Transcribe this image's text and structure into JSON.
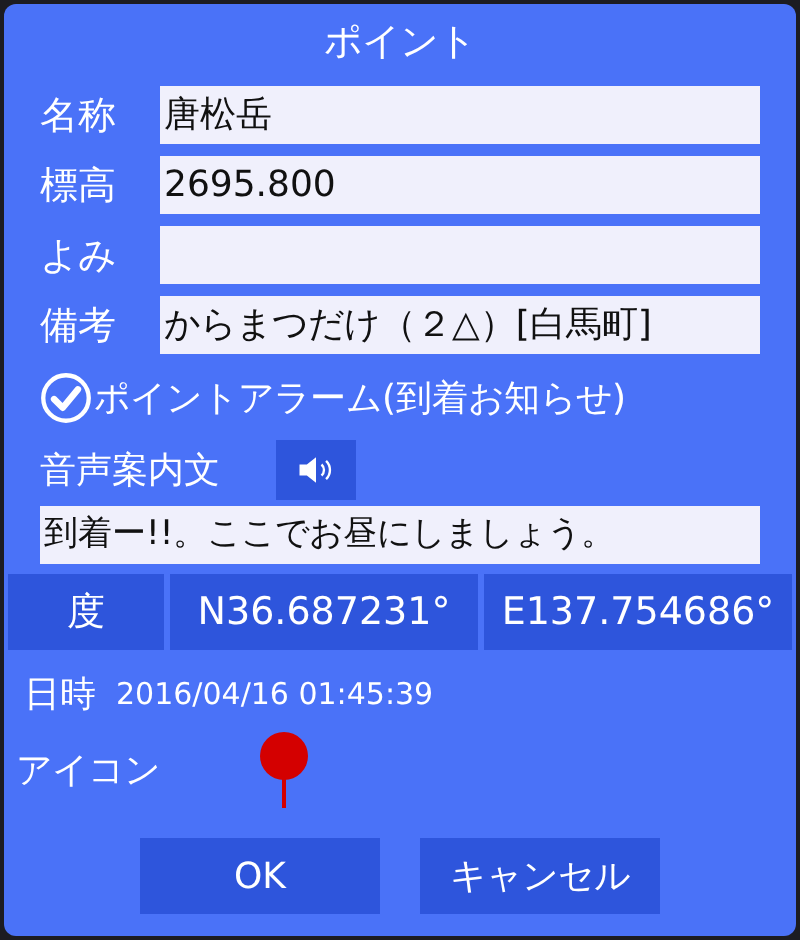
{
  "window": {
    "title": "ポイント"
  },
  "fields": [
    {
      "label": "名称",
      "value": "唐松岳"
    },
    {
      "label": "標高",
      "value": "2695.800"
    },
    {
      "label": "よみ"
    },
    {
      "label": "備考",
      "value": "からまつだけ（２△）[白馬町]"
    }
  ],
  "alarm": {
    "label": "ポイントアラーム(到着お知らせ)",
    "checked": true
  },
  "voice": {
    "label": "音声案内文",
    "message": "到着ー!!。ここでお昼にしましょう。"
  },
  "coords": {
    "unit": "度",
    "lat": "N36.687231°",
    "lon": "E137.754686°"
  },
  "datetime": {
    "label": "日時",
    "value": "2016/04/16 01:45:39"
  },
  "icon": {
    "label": "アイコン",
    "color": "#d40000"
  },
  "buttons": [
    "OK",
    "キャンセル"
  ]
}
